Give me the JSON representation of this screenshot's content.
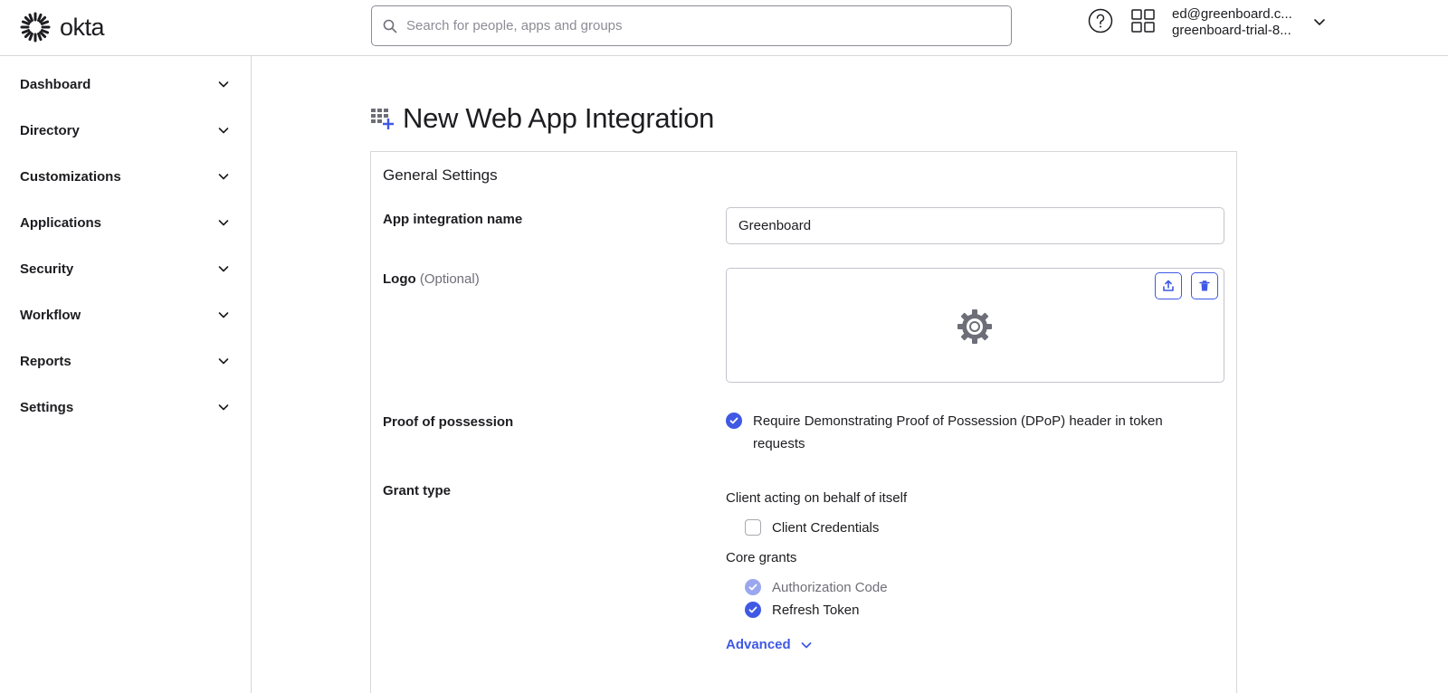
{
  "brand": {
    "name": "okta",
    "accent": "#3f59e4"
  },
  "header": {
    "search_placeholder": "Search for people, apps and groups",
    "user_email": "ed@greenboard.c...",
    "user_org": "greenboard-trial-8..."
  },
  "sidebar": {
    "items": [
      {
        "label": "Dashboard"
      },
      {
        "label": "Directory"
      },
      {
        "label": "Customizations"
      },
      {
        "label": "Applications"
      },
      {
        "label": "Security"
      },
      {
        "label": "Workflow"
      },
      {
        "label": "Reports"
      },
      {
        "label": "Settings"
      }
    ]
  },
  "page": {
    "title": "New Web App Integration",
    "section_title": "General Settings",
    "name_label": "App integration name",
    "name_value": "Greenboard",
    "logo_label": "Logo",
    "logo_optional": "(Optional)",
    "pop_label": "Proof of possession",
    "pop_text": "Require Demonstrating Proof of Possession (DPoP) header in token requests",
    "grant_label": "Grant type",
    "client_section": "Client acting on behalf of itself",
    "client_credentials": "Client Credentials",
    "core_section": "Core grants",
    "auth_code": "Authorization Code",
    "refresh_token": "Refresh Token",
    "advanced": "Advanced"
  }
}
